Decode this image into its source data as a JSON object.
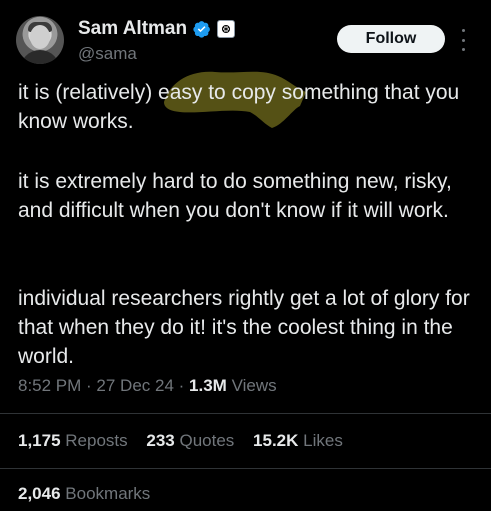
{
  "author": {
    "name": "Sam Altman",
    "handle": "@sama",
    "verified_color": "#1d9bf0"
  },
  "follow_label": "Follow",
  "tweet": {
    "p1_before": "it is (relatively) ",
    "p1_highlight": "easy to copy",
    "p1_after": " something that you know works.",
    "p2": "it is extremely hard to do something new, risky, and difficult when you don't know if it will work.",
    "p3": "individual researchers rightly get a lot of glory for that when they do it! it's the coolest thing in the world.",
    "highlight_color": "#5a5516"
  },
  "meta": {
    "time": "8:52 PM",
    "date": "27 Dec 24",
    "views_count": "1.3M",
    "views_label": "Views"
  },
  "stats": {
    "reposts_count": "1,175",
    "reposts_label": "Reposts",
    "quotes_count": "233",
    "quotes_label": "Quotes",
    "likes_count": "15.2K",
    "likes_label": "Likes",
    "bookmarks_count": "2,046",
    "bookmarks_label": "Bookmarks"
  }
}
